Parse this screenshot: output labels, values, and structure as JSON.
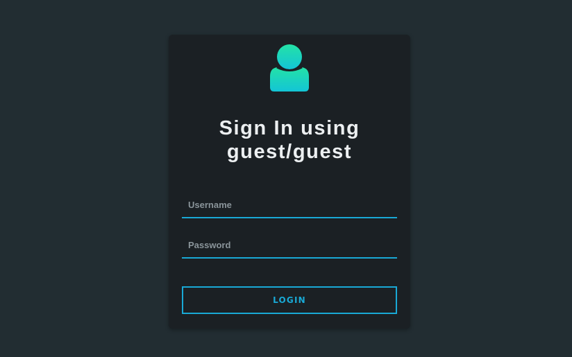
{
  "login": {
    "title_line1": "Sign In using",
    "title_line2": "guest/guest",
    "username_placeholder": "Username",
    "username_value": "",
    "password_placeholder": "Password",
    "password_value": "",
    "login_label": "LOGIN"
  },
  "icons": {
    "avatar": "user-avatar-icon"
  },
  "colors": {
    "page_background": "#222d32",
    "card_background": "#1b2024",
    "accent": "#19a9d6",
    "avatar_gradient_top": "#24e2a6",
    "avatar_gradient_bottom": "#13c5d6",
    "title_text": "#eceff1",
    "placeholder_text": "#8a949a"
  }
}
